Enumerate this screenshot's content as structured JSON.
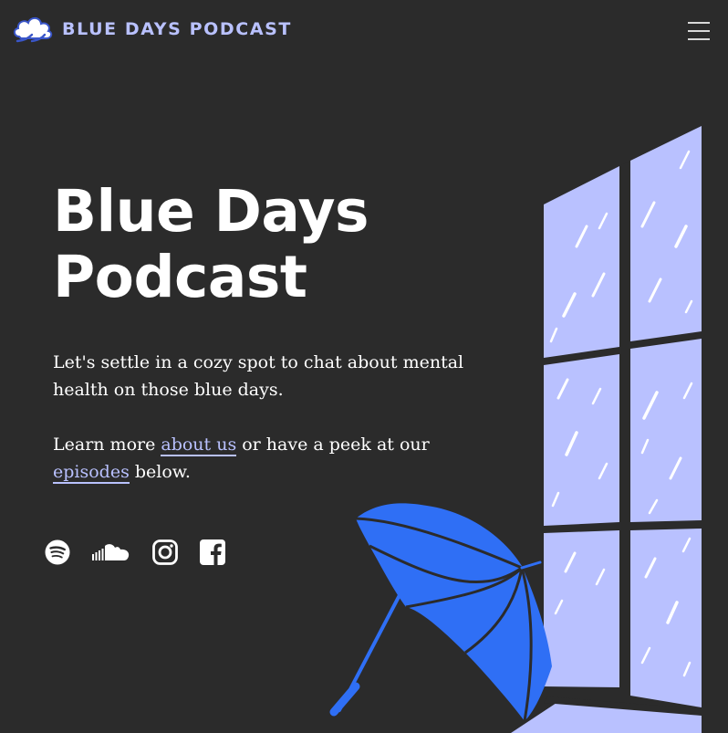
{
  "header": {
    "brand_name": "BLUE DAYS PODCAST",
    "brand_icon": "cloud-icon",
    "menu_icon": "hamburger-menu-icon"
  },
  "hero": {
    "title_line1": "Blue Days",
    "title_line2": "Podcast",
    "intro": "Let's settle in a cozy spot to chat about mental health on those blue days.",
    "more_prefix": "Learn more ",
    "about_link": "about us",
    "more_middle": " or have a peek at our",
    "episodes_link": "episodes",
    "more_suffix": " below."
  },
  "socials": [
    {
      "name": "Spotify",
      "icon": "spotify-icon"
    },
    {
      "name": "SoundCloud",
      "icon": "soundcloud-icon"
    },
    {
      "name": "Instagram",
      "icon": "instagram-icon"
    },
    {
      "name": "Facebook",
      "icon": "facebook-icon"
    }
  ],
  "colors": {
    "background": "#2b2b2b",
    "accent": "#b9c1ff",
    "window_glass": "#b9c1ff",
    "umbrella": "#2f6ff5",
    "text": "#ffffff"
  }
}
